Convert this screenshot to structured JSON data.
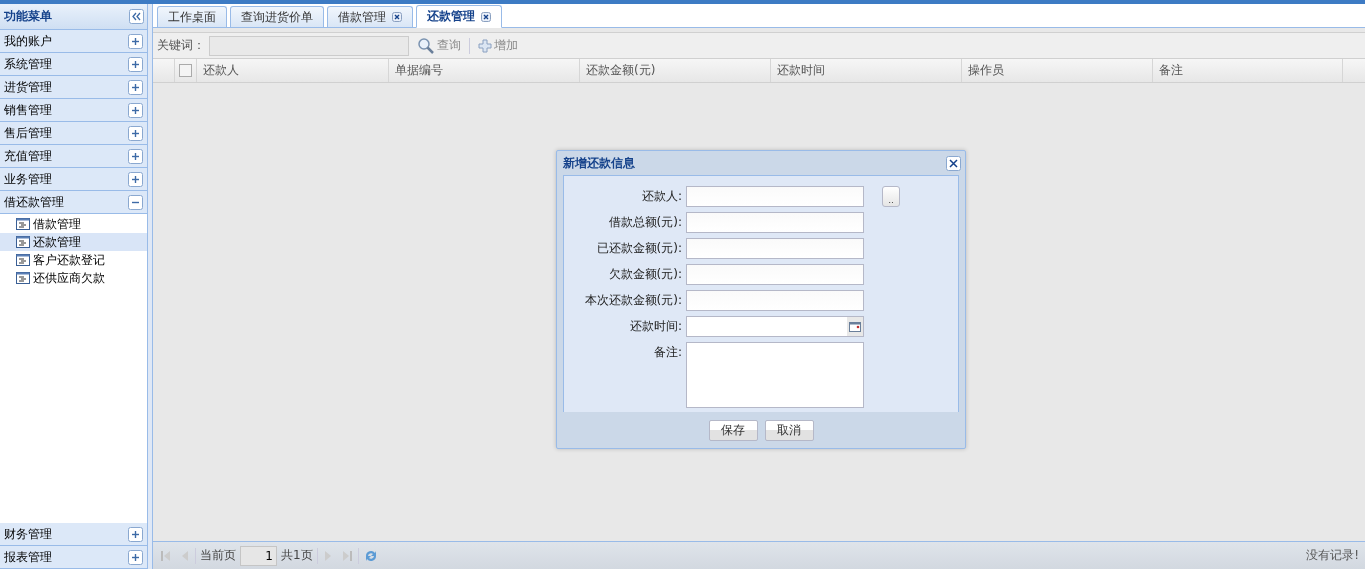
{
  "sidebar": {
    "title": "功能菜单",
    "sections": [
      {
        "label": "我的账户",
        "expanded": false
      },
      {
        "label": "系统管理",
        "expanded": false
      },
      {
        "label": "进货管理",
        "expanded": false
      },
      {
        "label": "销售管理",
        "expanded": false
      },
      {
        "label": "售后管理",
        "expanded": false
      },
      {
        "label": "充值管理",
        "expanded": false
      },
      {
        "label": "业务管理",
        "expanded": false
      },
      {
        "label": "借还款管理",
        "expanded": true,
        "items": [
          {
            "label": "借款管理",
            "selected": false
          },
          {
            "label": "还款管理",
            "selected": true
          },
          {
            "label": "客户还款登记",
            "selected": false
          },
          {
            "label": "还供应商欠款",
            "selected": false
          }
        ]
      }
    ],
    "bottom_sections": [
      {
        "label": "财务管理",
        "expanded": false
      },
      {
        "label": "报表管理",
        "expanded": false
      }
    ]
  },
  "tabs": [
    {
      "label": "工作桌面",
      "selected": false,
      "closable": false
    },
    {
      "label": "查询进货价单",
      "selected": false,
      "closable": false
    },
    {
      "label": "借款管理",
      "selected": false,
      "closable": true
    },
    {
      "label": "还款管理",
      "selected": true,
      "closable": true
    }
  ],
  "toolbar": {
    "keyword_label": "关键词：",
    "search": "查询",
    "add": "增加"
  },
  "grid": {
    "select_all_checked": false,
    "columns": [
      "还款人",
      "单据编号",
      "还款金额(元)",
      "还款时间",
      "操作员",
      "备注"
    ]
  },
  "pager": {
    "current_label": "当前页",
    "page": "1",
    "total": "共1页",
    "status": "没有记录!"
  },
  "dialog": {
    "title": "新增还款信息",
    "fields": [
      {
        "label": "还款人:",
        "kind": "picker"
      },
      {
        "label": "借款总额(元):",
        "kind": "text"
      },
      {
        "label": "已还款金额(元):",
        "kind": "text"
      },
      {
        "label": "欠款金额(元):",
        "kind": "text"
      },
      {
        "label": "本次还款金额(元):",
        "kind": "text"
      },
      {
        "label": "还款时间:",
        "kind": "date"
      },
      {
        "label": "备注:",
        "kind": "textarea"
      }
    ],
    "picker_button": "..",
    "buttons": [
      "保存",
      "取消"
    ]
  }
}
